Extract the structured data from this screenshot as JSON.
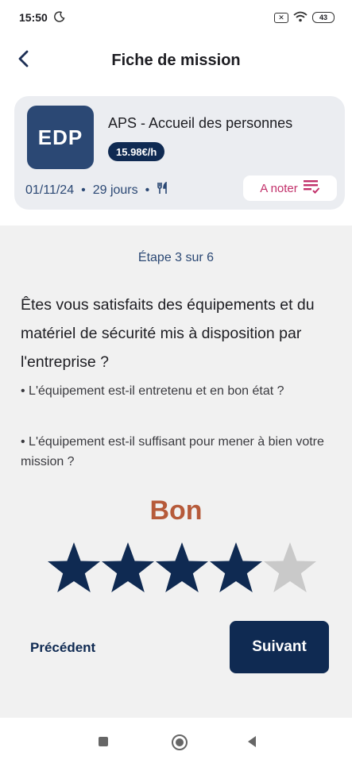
{
  "status_bar": {
    "time": "15:50",
    "moon_icon": "moon-icon",
    "sim_icon": "sim-icon",
    "wifi_icon": "wifi-icon",
    "battery": "43"
  },
  "header": {
    "title": "Fiche de mission",
    "back_icon": "chevron-left-icon"
  },
  "mission": {
    "logo_text": "EDP",
    "title": "APS - Accueil des personnes",
    "rate": "15.98€/h",
    "date": "01/11/24",
    "separator": "•",
    "duration": "29 jours",
    "meal_icon": "utensils-icon",
    "rate_button_label": "A noter",
    "rate_button_icon": "checklist-icon"
  },
  "question": {
    "step_label": "Étape 3 sur 6",
    "text": "Êtes vous satisfaits des équipements et du matériel de sécurité mis à disposition par l'entreprise ?",
    "bullets": [
      "• L'équipement est-il entretenu et en bon état ?",
      "• L'équipement est-il suffisant pour mener à bien votre mission ?"
    ],
    "rating_label": "Bon",
    "rating_value": 4,
    "rating_max": 5
  },
  "actions": {
    "previous_label": "Précédent",
    "next_label": "Suivant"
  },
  "colors": {
    "primary": "#0f2a52",
    "logo_bg": "#2b4874",
    "accent_pink": "#c2306a",
    "rating_text": "#b65a3a",
    "star_filled": "#0f2a52",
    "star_empty": "#c9c9c9"
  }
}
